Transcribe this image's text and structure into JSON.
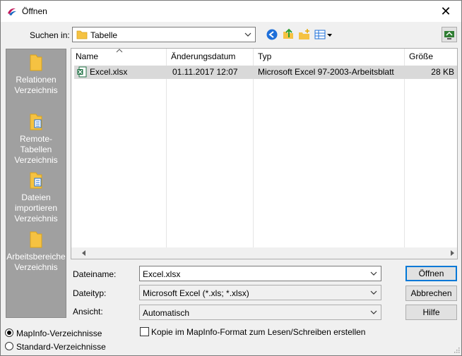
{
  "window": {
    "title": "Öffnen"
  },
  "toolbar": {
    "look_in_label": "Suchen in:",
    "look_in_value": "Tabelle"
  },
  "places": [
    {
      "label": "Relationen Verzeichnis"
    },
    {
      "label": "Remote-Tabellen Verzeichnis"
    },
    {
      "label": "Dateien importieren Verzeichnis"
    },
    {
      "label": "Arbeitsbereiche Verzeichnis"
    }
  ],
  "file_list": {
    "columns": [
      "Name",
      "Änderungsdatum",
      "Typ",
      "Größe"
    ],
    "rows": [
      {
        "name": "Excel.xlsx",
        "modified": "01.11.2017 12:07",
        "type": "Microsoft Excel 97-2003-Arbeitsblatt",
        "size": "28 KB"
      }
    ]
  },
  "form": {
    "filename_label": "Dateiname:",
    "filename_value": "Excel.xlsx",
    "filetype_label": "Dateityp:",
    "filetype_value": "Microsoft Excel (*.xls; *.xlsx)",
    "view_label": "Ansicht:",
    "view_value": "Automatisch",
    "copy_checkbox_label": "Kopie im MapInfo-Format zum Lesen/Schreiben erstellen"
  },
  "buttons": {
    "open": "Öffnen",
    "cancel": "Abbrechen",
    "help": "Hilfe"
  },
  "radios": [
    {
      "label": "MapInfo-Verzeichnisse",
      "checked": true
    },
    {
      "label": "Standard-Verzeichnisse",
      "checked": false
    }
  ]
}
